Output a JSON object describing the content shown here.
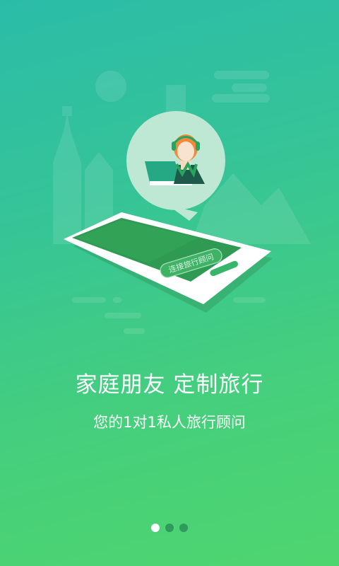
{
  "onboarding": {
    "illustration": {
      "phone_button_label": "连接旅行顾问",
      "icon": "travel-advisor-icon"
    },
    "title": "家庭朋友 定制旅行",
    "subtitle": "您的1对1私人旅行顾问",
    "pager": {
      "pages": 3,
      "active_index": 0
    }
  },
  "colors": {
    "gradient_top": "#2bbca8",
    "gradient_bottom": "#4fd56f",
    "phone_screen": "#2e9a52",
    "dot_inactive": "#2e9a5c",
    "dot_active": "#ffffff",
    "advisor_hair": "#f08a3a",
    "headset": "#3bbf6a"
  }
}
